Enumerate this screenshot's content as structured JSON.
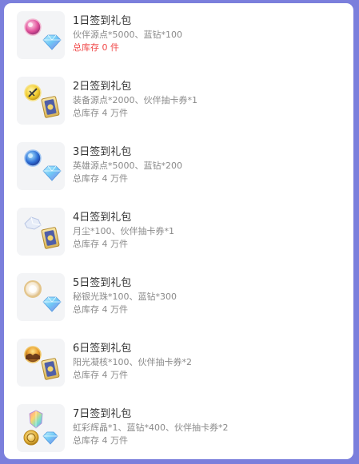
{
  "accent_color": "#7b7fdc",
  "empty_stock_color": "#f04848",
  "gifts": [
    {
      "title": "1日签到礼包",
      "desc": "伙伴源点*5000、蓝钻*100",
      "stock": "总库存 0 件",
      "stock_empty": true,
      "icons": [
        "pink-orb-icon",
        "diamond-icon"
      ]
    },
    {
      "title": "2日签到礼包",
      "desc": "装备源点*2000、伙伴抽卡券*1",
      "stock": "总库存 4 万件",
      "stock_empty": false,
      "icons": [
        "gold-sword-orb-icon",
        "card-ticket-icon"
      ]
    },
    {
      "title": "3日签到礼包",
      "desc": "英雄源点*5000、蓝钻*200",
      "stock": "总库存 4 万件",
      "stock_empty": false,
      "icons": [
        "blue-orb-icon",
        "diamond-icon"
      ]
    },
    {
      "title": "4日签到礼包",
      "desc": "月尘*100、伙伴抽卡券*1",
      "stock": "总库存 4 万件",
      "stock_empty": false,
      "icons": [
        "moondust-crystal-icon",
        "card-ticket-icon"
      ]
    },
    {
      "title": "5日签到礼包",
      "desc": "秘银光珠*100、蓝钻*300",
      "stock": "总库存 4 万件",
      "stock_empty": false,
      "icons": [
        "mithril-pearl-icon",
        "diamond-icon"
      ]
    },
    {
      "title": "6日签到礼包",
      "desc": "阳光凝核*100、伙伴抽卡券*2",
      "stock": "总库存 4 万件",
      "stock_empty": false,
      "icons": [
        "sunlight-core-icon",
        "card-ticket-icon"
      ]
    },
    {
      "title": "7日签到礼包",
      "desc": "虹彩辉晶*1、蓝钻*400、伙伴抽卡券*2",
      "stock": "总库存 4 万件",
      "stock_empty": false,
      "icons": [
        "rainbow-crystal-icon",
        "gold-coin-icon",
        "diamond-icon"
      ]
    }
  ]
}
